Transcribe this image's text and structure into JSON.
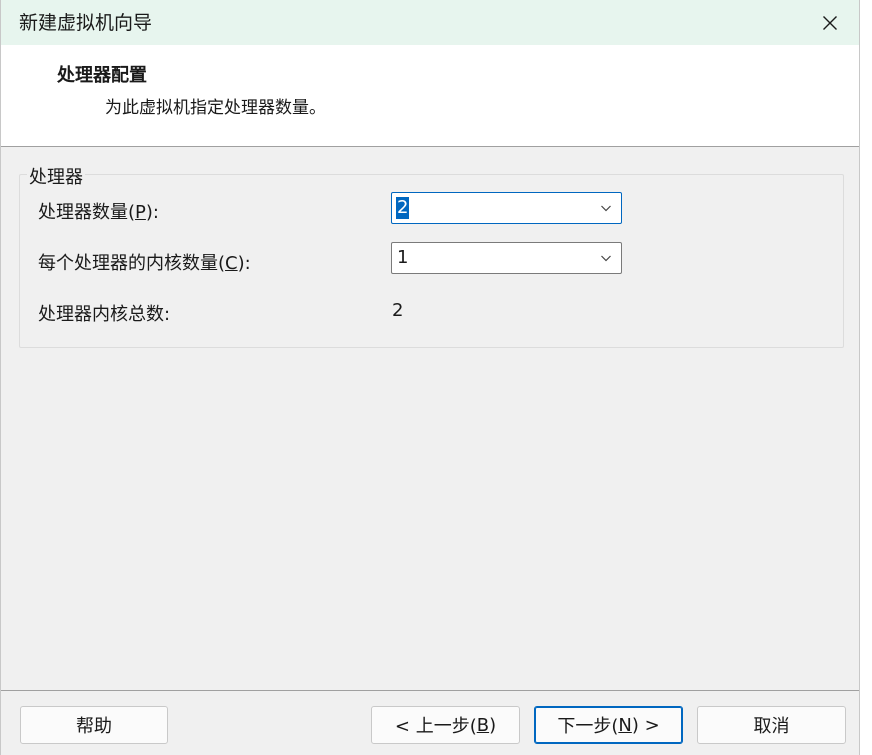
{
  "window": {
    "title": "新建虚拟机向导",
    "close_label": "关闭"
  },
  "header": {
    "title": "处理器配置",
    "description": "为此虚拟机指定处理器数量。"
  },
  "processor_group": {
    "legend": "处理器",
    "processor_count": {
      "label_prefix": "处理器数量(",
      "mnemonic": "P",
      "label_suffix": "):",
      "value": "2"
    },
    "cores_per_processor": {
      "label_prefix": "每个处理器的内核数量(",
      "mnemonic": "C",
      "label_suffix": "):",
      "value": "1"
    },
    "total_cores": {
      "label": "处理器内核总数:",
      "value": "2"
    }
  },
  "footer": {
    "help": "帮助",
    "back_prefix": "< 上一步(",
    "back_mnemonic": "B",
    "back_suffix": ")",
    "next_prefix": "下一步(",
    "next_mnemonic": "N",
    "next_suffix": ") >",
    "cancel": "取消"
  },
  "colors": {
    "titlebar": "#e7f5ee",
    "accent": "#0067c0",
    "dialog_bg": "#f0f0f0"
  }
}
